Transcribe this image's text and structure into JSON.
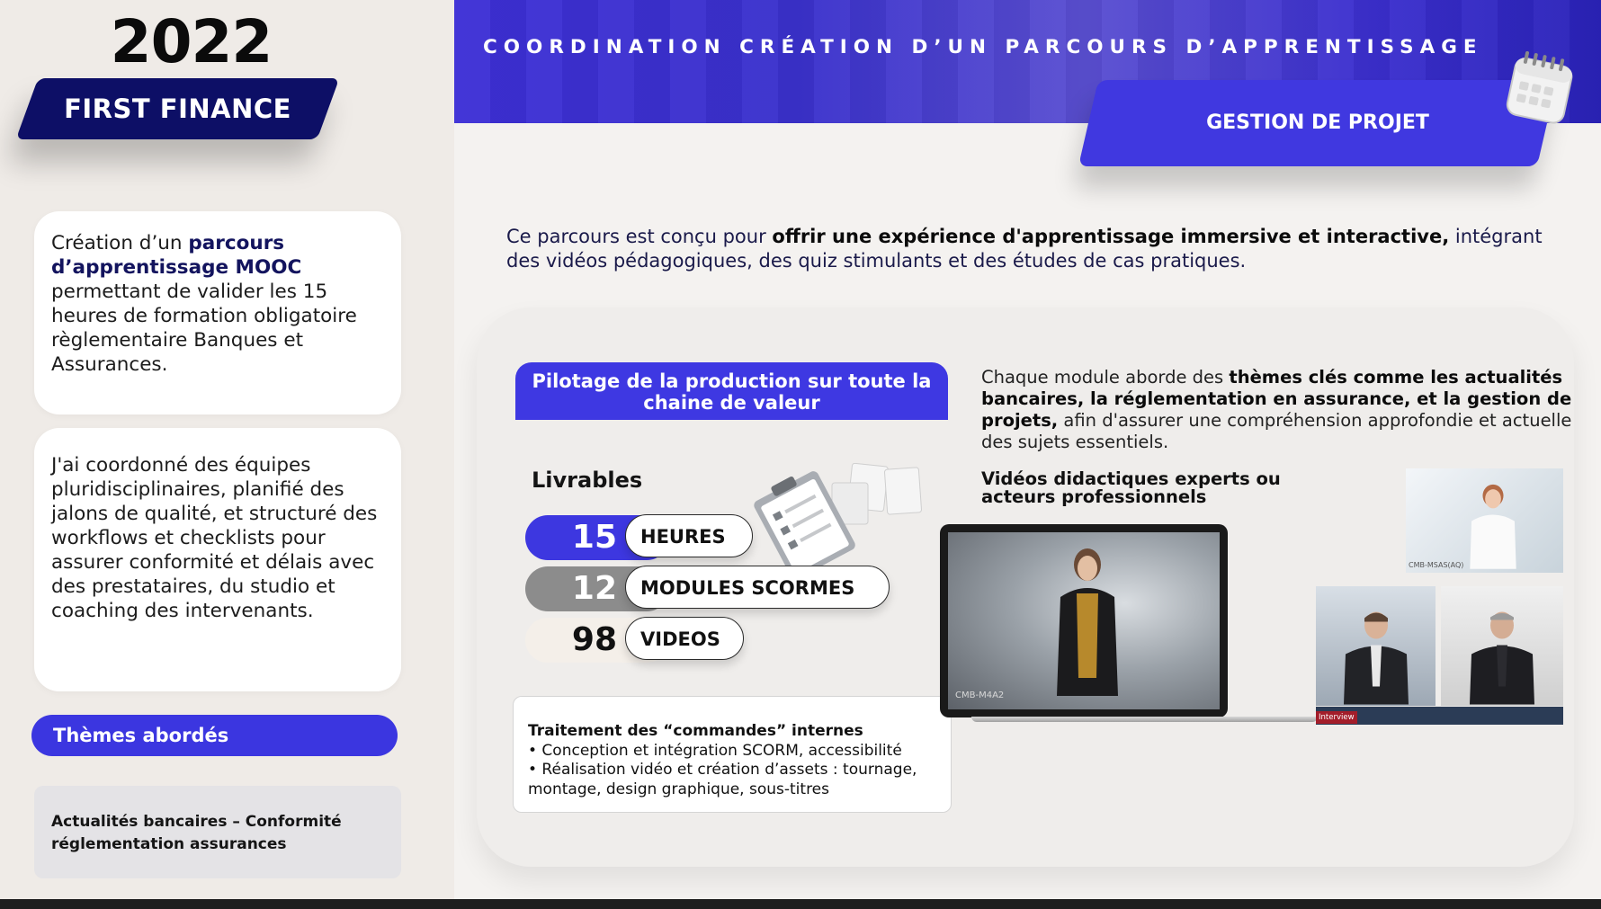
{
  "left": {
    "year": "2022",
    "company": "FIRST FINANCE",
    "mooc_card": {
      "text_before": "Création d’un ",
      "highlight": "parcours d’apprentissage MOOC",
      "text_after": " permettant de valider les 15 heures de formation obligatoire règlementaire Banques et Assurances."
    },
    "role_card": "J'ai coordonné des équipes pluridisciplinaires, planifié des jalons de qualité, et structuré des workflows et checklists pour assurer conformité et délais avec des prestataires, du studio et coaching des intervenants.",
    "themes_label": "Thèmes abordés",
    "themes_text": "Actualités bancaires – Conformité réglementation assurances"
  },
  "header": {
    "title": "COORDINATION CRÉATION D’UN PARCOURS D’APPRENTISSAGE",
    "tab": "GESTION DE PROJET",
    "icon": "calendar-icon"
  },
  "intro": {
    "before": "Ce parcours est conçu pour ",
    "bold": "offrir une expérience d'apprentissage immersive et interactive,",
    "after": " intégrant des vidéos pédagogiques, des quiz stimulants et des études de cas pratiques."
  },
  "production": {
    "title": "Pilotage de la production sur toute la chaine de valeur",
    "livrables_label": "Livrables",
    "stats": [
      {
        "value": "15",
        "label": "HEURES"
      },
      {
        "value": "12",
        "label": "MODULES SCORMES"
      },
      {
        "value": "98",
        "label": "VIDEOS"
      }
    ],
    "orders_title": "Traitement des “commandes” internes",
    "orders_items": [
      "• Conception et intégration SCORM, accessibilité",
      "• Réalisation vidéo et création d’assets : tournage, montage, design graphique, sous-titres"
    ]
  },
  "modules": {
    "before": "Chaque module aborde des ",
    "bold1": "thèmes clés comme les actualités bancaires, la réglementation en assurance, et la gestion de projets,",
    "after": " afin d'assurer une compréhension approfondie et actuelle des sujets essentiels."
  },
  "videos": {
    "title": "Vidéos didactiques experts ou acteurs professionnels",
    "laptop_caption": "CMB-M4A2",
    "thumb_caption": "CMB-MSAS(AQ)",
    "interview_label": "Interview"
  },
  "colors": {
    "accent": "#3d37e0",
    "navy": "#0d0f66",
    "gray_stat": "#8c8c8c"
  }
}
